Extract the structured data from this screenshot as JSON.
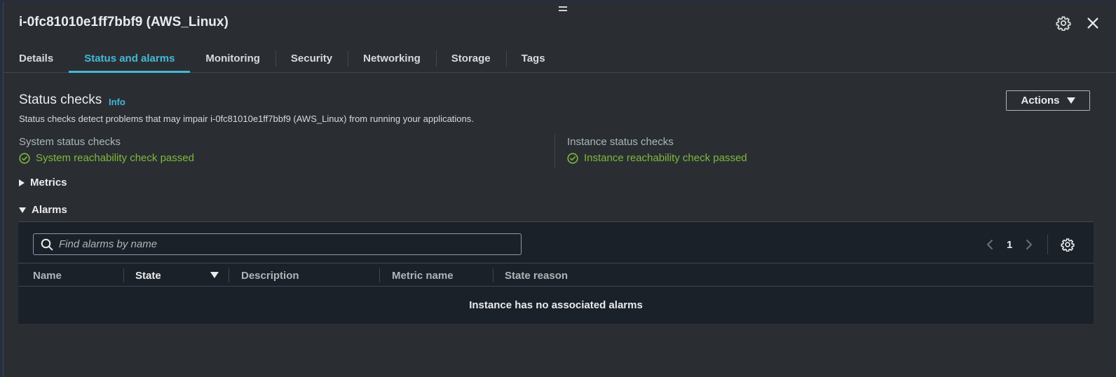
{
  "panel": {
    "title": "i-0fc81010e1ff7bbf9 (AWS_Linux)"
  },
  "tabs": [
    {
      "label": "Details"
    },
    {
      "label": "Status and alarms"
    },
    {
      "label": "Monitoring"
    },
    {
      "label": "Security"
    },
    {
      "label": "Networking"
    },
    {
      "label": "Storage"
    },
    {
      "label": "Tags"
    }
  ],
  "active_tab": "Status and alarms",
  "status_checks": {
    "title": "Status checks",
    "info": "Info",
    "description": "Status checks detect problems that may impair i-0fc81010e1ff7bbf9 (AWS_Linux) from running your applications.",
    "actions_label": "Actions",
    "system": {
      "label": "System status checks",
      "result": "System reachability check passed"
    },
    "instance": {
      "label": "Instance status checks",
      "result": "Instance reachability check passed"
    }
  },
  "sections": {
    "metrics": "Metrics",
    "alarms": "Alarms"
  },
  "alarms_table": {
    "search_placeholder": "Find alarms by name",
    "page": "1",
    "columns": [
      "Name",
      "State",
      "Description",
      "Metric name",
      "State reason"
    ],
    "sorted_column": "State",
    "empty_message": "Instance has no associated alarms"
  },
  "colors": {
    "accent": "#44b9d6",
    "success": "#7fb93a",
    "background": "#2a2e33"
  }
}
